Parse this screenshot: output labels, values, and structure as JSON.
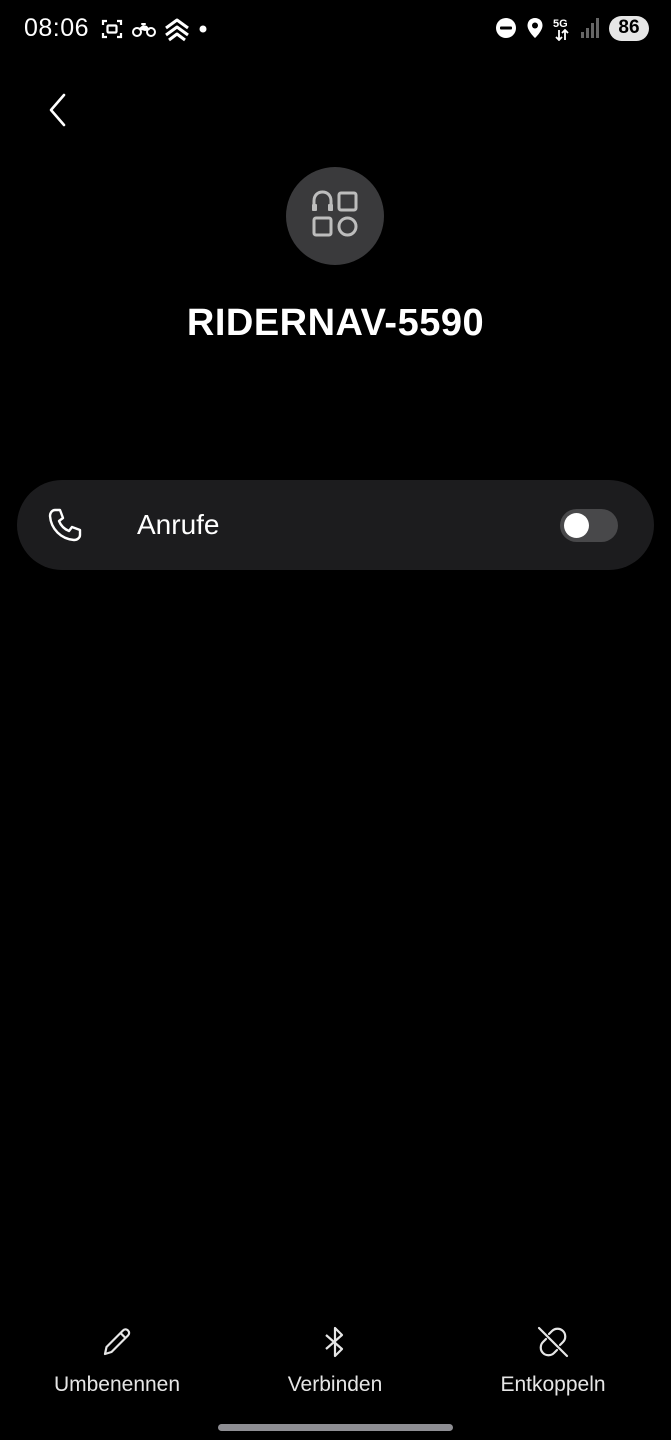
{
  "status_bar": {
    "time": "08:06",
    "network": "5G",
    "battery": "86",
    "left_icons": [
      "screenshot-icon",
      "motorcycle-icon",
      "navigation-chevrons-icon",
      "dot-icon"
    ],
    "right_icons": [
      "do-not-disturb-icon",
      "location-icon",
      "network-5g-icon",
      "signal-icon"
    ]
  },
  "header": {
    "back_icon": "chevron-left-icon"
  },
  "device": {
    "icon": "device-category-icon",
    "name": "RIDERNAV-5590"
  },
  "settings": {
    "calls": {
      "icon": "phone-icon",
      "label": "Anrufe",
      "enabled": false
    }
  },
  "actions": {
    "rename": {
      "icon": "pencil-icon",
      "label": "Umbenennen"
    },
    "connect": {
      "icon": "bluetooth-icon",
      "label": "Verbinden"
    },
    "unpair": {
      "icon": "unlink-icon",
      "label": "Entkoppeln"
    }
  },
  "colors": {
    "background": "#000000",
    "card": "#1c1c1e",
    "avatar": "#3a3a3c",
    "toggle_off": "#48484a",
    "text": "#ffffff"
  }
}
